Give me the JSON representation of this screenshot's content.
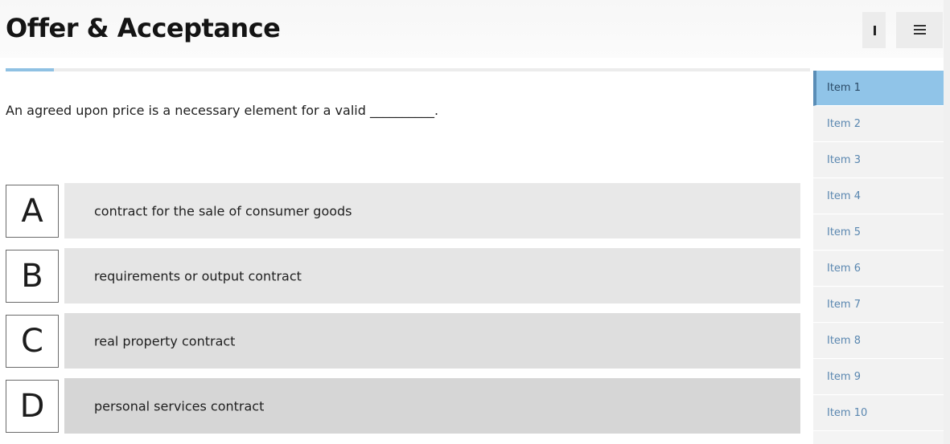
{
  "header": {
    "title": "Offer & Acceptance",
    "pause_icon": "pause-icon",
    "list_icon": "list-icon"
  },
  "progress": {
    "fraction": 0.06,
    "color": "#8fc1e3"
  },
  "question": {
    "text": "An agreed upon price is a necessary element for a valid __________."
  },
  "answers": [
    {
      "letter": "A",
      "text": "contract for the sale of consumer goods"
    },
    {
      "letter": "B",
      "text": "requirements or output contract"
    },
    {
      "letter": "C",
      "text": "real property contract"
    },
    {
      "letter": "D",
      "text": "personal services contract"
    }
  ],
  "sidebar": {
    "active_index": 0,
    "items": [
      {
        "label": "Item 1"
      },
      {
        "label": "Item 2"
      },
      {
        "label": "Item 3"
      },
      {
        "label": "Item 4"
      },
      {
        "label": "Item 5"
      },
      {
        "label": "Item 6"
      },
      {
        "label": "Item 7"
      },
      {
        "label": "Item 8"
      },
      {
        "label": "Item 9"
      },
      {
        "label": "Item 10"
      }
    ]
  },
  "colors": {
    "accent": "#8fc1e3",
    "active_item": "#90c4e8",
    "item_text": "#5a87b0",
    "answer_bar": "#e6e6e6"
  }
}
